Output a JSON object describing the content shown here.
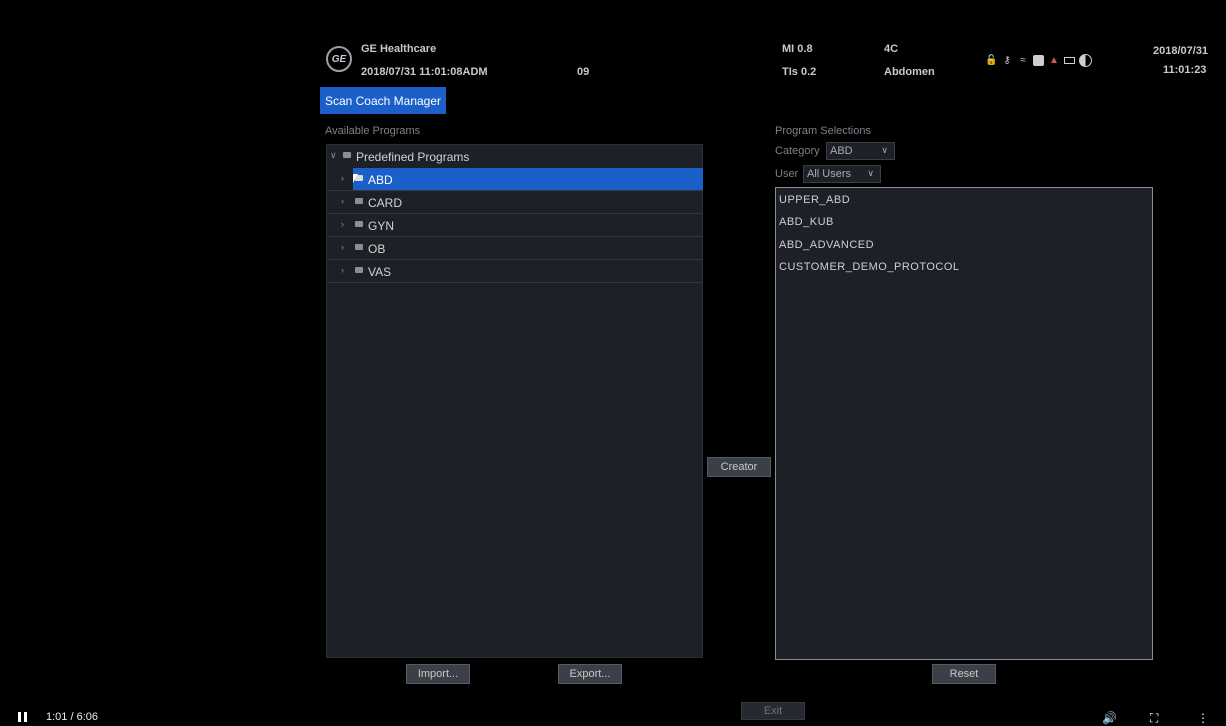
{
  "header": {
    "logo_text": "GE",
    "brand": "GE Healthcare",
    "datetime_user": "2018/07/31 11:01:08ADM",
    "field_09": "09",
    "mi": "MI 0.8",
    "tis": "TIs 0.2",
    "probe": "4C",
    "preset": "Abdomen",
    "date": "2018/07/31",
    "time": "11:01:23"
  },
  "title_button": "Scan Coach Manager",
  "available": {
    "label": "Available Programs",
    "root": "Predefined Programs",
    "items": [
      "ABD",
      "CARD",
      "GYN",
      "OB",
      "VAS"
    ],
    "selected": "ABD"
  },
  "buttons": {
    "import": "Import...",
    "export": "Export...",
    "creator": "Creator",
    "reset": "Reset",
    "exit": "Exit"
  },
  "selections": {
    "label": "Program Selections",
    "category_label": "Category",
    "category_value": "ABD",
    "user_label": "User",
    "user_value": "All Users",
    "programs": [
      "UPPER_ABD",
      "ABD_KUB",
      "ABD_ADVANCED",
      "CUSTOMER_DEMO_PROTOCOL"
    ]
  },
  "video": {
    "time": "1:01 / 6:06"
  },
  "icons": [
    "lock-icon",
    "key-icon",
    "wifi-icon",
    "drive-icon",
    "network-icon",
    "battery-icon",
    "contrast-icon"
  ],
  "colors": {
    "accent": "#1b5fc9",
    "panel": "#1d2127"
  }
}
